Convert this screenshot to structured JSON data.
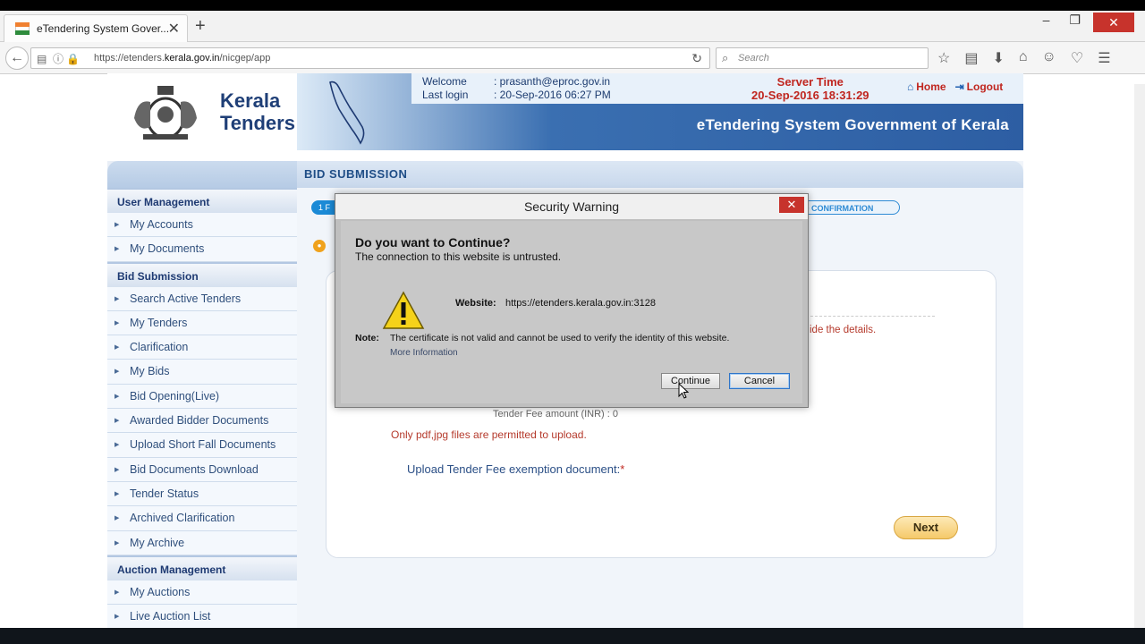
{
  "browser": {
    "tab_title": "eTendering System Gover...",
    "url_prefix": "https://etenders.",
    "url_domain": "kerala.gov.in",
    "url_suffix": "/nicgep/app",
    "search_placeholder": "Search"
  },
  "header": {
    "brand_line1": "Kerala",
    "brand_line2": "Tenders",
    "welcome_label": "Welcome",
    "welcome_value": ":  prasanth@eproc.gov.in",
    "last_login_label": "Last login",
    "last_login_value": ":  20-Sep-2016 06:27 PM",
    "server_time_label": "Server Time",
    "server_time_value": "20-Sep-2016 18:31:29",
    "home_label": "Home",
    "logout_label": "Logout",
    "system_title": "eTendering System Government of Kerala"
  },
  "sidebar": {
    "section1": "User Management",
    "items1": [
      "My Accounts",
      "My Documents"
    ],
    "section2": "Bid Submission",
    "items2": [
      "Search Active Tenders",
      "My Tenders",
      "Clarification",
      "My Bids",
      "Bid Opening(Live)",
      "Awarded Bidder Documents",
      "Upload Short Fall Documents",
      "Bid Documents Download",
      "Tender Status",
      "Archived Clarification",
      "My Archive"
    ],
    "section3": "Auction Management",
    "items3": [
      "My Auctions",
      "Live Auction List"
    ]
  },
  "content": {
    "title": "BID SUBMISSION",
    "step1": "1  F",
    "step5": "D CONFIRMATION",
    "provide_text": "ide the details.",
    "fee_partial": "Tender Fee amount (INR) : 0",
    "only_pdf": "Only pdf,jpg files are permitted to upload.",
    "upload_label": "Upload Tender Fee exemption document:",
    "required_mark": "*",
    "next_label": "Next"
  },
  "dialog": {
    "title": "Security Warning",
    "close": "✕",
    "question": "Do you want to Continue?",
    "subtitle": "The connection to this website is untrusted.",
    "website_label": "Website:",
    "website_value": "https://etenders.kerala.gov.in:3128",
    "note_label": "Note:",
    "note_value": "The certificate is not valid and cannot be used to verify the identity of this website.",
    "more_info": "More Information",
    "continue_label": "Continue",
    "cancel_label": "Cancel"
  }
}
